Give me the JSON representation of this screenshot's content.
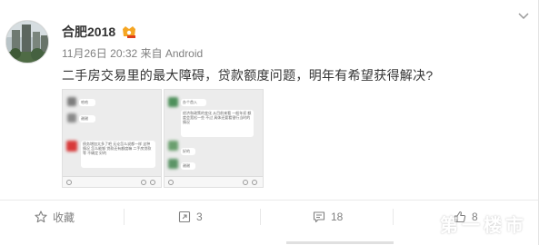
{
  "post": {
    "user_name": "合肥2018",
    "meta": "11月26日 20:32 来自 Android",
    "text": "二手房交易里的最大障碍，贷款额度问题，明年有希望获得解决?"
  },
  "thumbnails": {
    "first": {
      "bubbles": [
        "哈哈",
        "谢谢",
        "债务增加太多了吧 无论怎么说都一样 这种情况 怎么能够 贷款还有额度嘛 二手房贷款 等 不确定 好的"
      ]
    },
    "second": {
      "bubbles": [
        "办个首入",
        "经济和政策的变化 从目前来看 一般年初 额度会宽松一些 不过 具体还要看银行当时的情况",
        "好的",
        "谢谢"
      ]
    }
  },
  "actions": {
    "favorite_label": "收藏",
    "repost_count": "3",
    "comment_count": "18",
    "like_count": "8"
  },
  "watermark": {
    "text": "第一楼市"
  },
  "colors": {
    "text": "#333333",
    "meta": "#808080",
    "vip_badge": "#f5a623"
  }
}
